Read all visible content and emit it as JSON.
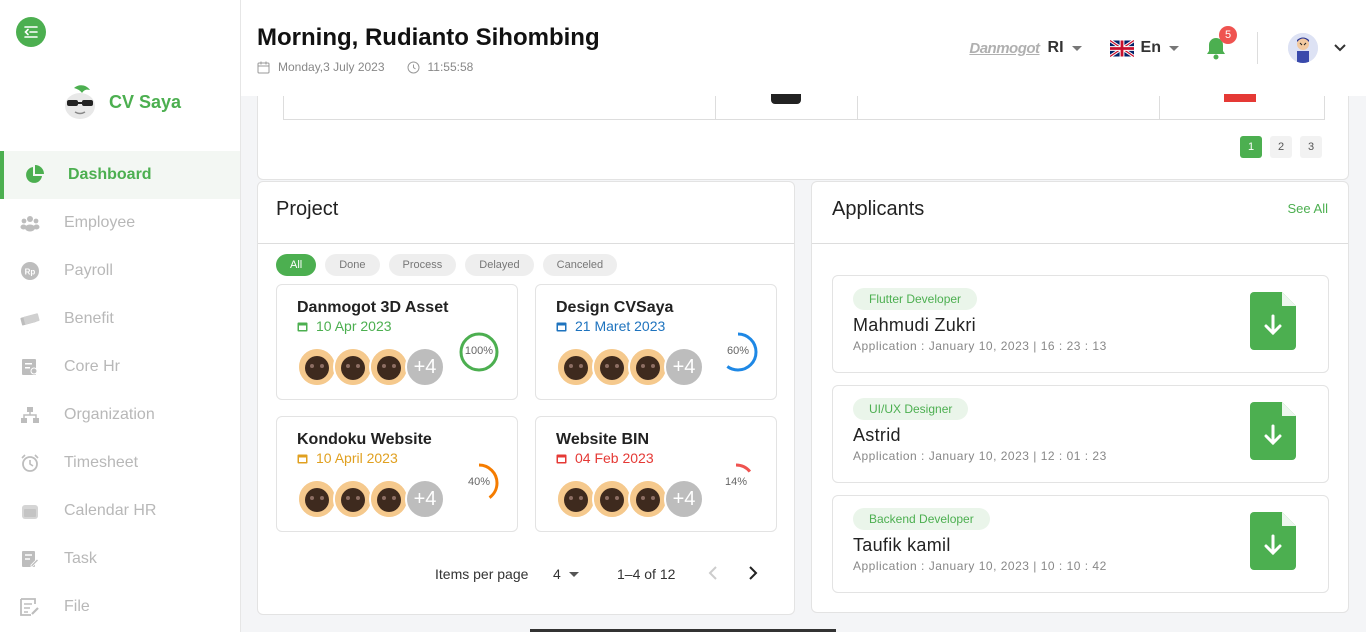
{
  "brand": {
    "name": "CV Saya"
  },
  "sidebar": {
    "items": [
      {
        "label": "Dashboard",
        "icon": "pie-chart-icon",
        "active": true
      },
      {
        "label": "Employee",
        "icon": "users-icon"
      },
      {
        "label": "Payroll",
        "icon": "rupiah-icon"
      },
      {
        "label": "Benefit",
        "icon": "money-icon"
      },
      {
        "label": "Core Hr",
        "icon": "id-card-icon"
      },
      {
        "label": "Organization",
        "icon": "org-chart-icon"
      },
      {
        "label": "Timesheet",
        "icon": "alarm-icon"
      },
      {
        "label": "Calendar HR",
        "icon": "calendar-icon"
      },
      {
        "label": "Task",
        "icon": "task-icon"
      },
      {
        "label": "File",
        "icon": "file-icon"
      }
    ]
  },
  "header": {
    "greeting": "Morning, Rudianto Sihombing",
    "date": "Monday,3 July 2023",
    "time": "11:55:58",
    "company_logo_text": "Danmogot",
    "company_code": "RI",
    "language": "En",
    "notification_count": "5"
  },
  "top_pager": {
    "pages": [
      "1",
      "2",
      "3"
    ],
    "active": "1"
  },
  "project": {
    "title": "Project",
    "filters": [
      "All",
      "Done",
      "Process",
      "Delayed",
      "Canceled"
    ],
    "active_filter": "All",
    "cards": [
      {
        "title": "Danmogot 3D Asset",
        "date": "10 Apr 2023",
        "date_color": "#4caf50",
        "progress": 100,
        "progress_label": "100%",
        "ring_color": "#4caf50",
        "more": "+4"
      },
      {
        "title": "Design CVSaya",
        "date": "21 Maret 2023",
        "date_color": "#1e73be",
        "progress": 60,
        "progress_label": "60%",
        "ring_color": "#1e88e5",
        "more": "+4"
      },
      {
        "title": "Kondoku Website",
        "date": "10 April 2023",
        "date_color": "#e0a020",
        "progress": 40,
        "progress_label": "40%",
        "ring_color": "#f57c00",
        "more": "+4"
      },
      {
        "title": "Website BIN",
        "date": "04 Feb 2023",
        "date_color": "#e53935",
        "progress": 14,
        "progress_label": "14%",
        "ring_color": "#ef5350",
        "more": "+4"
      }
    ],
    "pager": {
      "items_per_page_label": "Items per page",
      "items_per_page": "4",
      "range": "1–4 of 12"
    }
  },
  "applicants": {
    "title": "Applicants",
    "see_all": "See All",
    "items": [
      {
        "role": "Flutter Developer",
        "name": "Mahmudi Zukri",
        "date": "Application : January 10, 2023 | 16 : 23 : 13"
      },
      {
        "role": "UI/UX Designer",
        "name": "Astrid",
        "date": "Application : January 10, 2023 | 12 : 01 : 23"
      },
      {
        "role": "Backend Developer",
        "name": "Taufik kamil",
        "date": "Application : January 10, 2023 | 10 : 10 : 42"
      }
    ]
  },
  "colors": {
    "accent": "#4caf50",
    "badge": "#ef5350"
  }
}
